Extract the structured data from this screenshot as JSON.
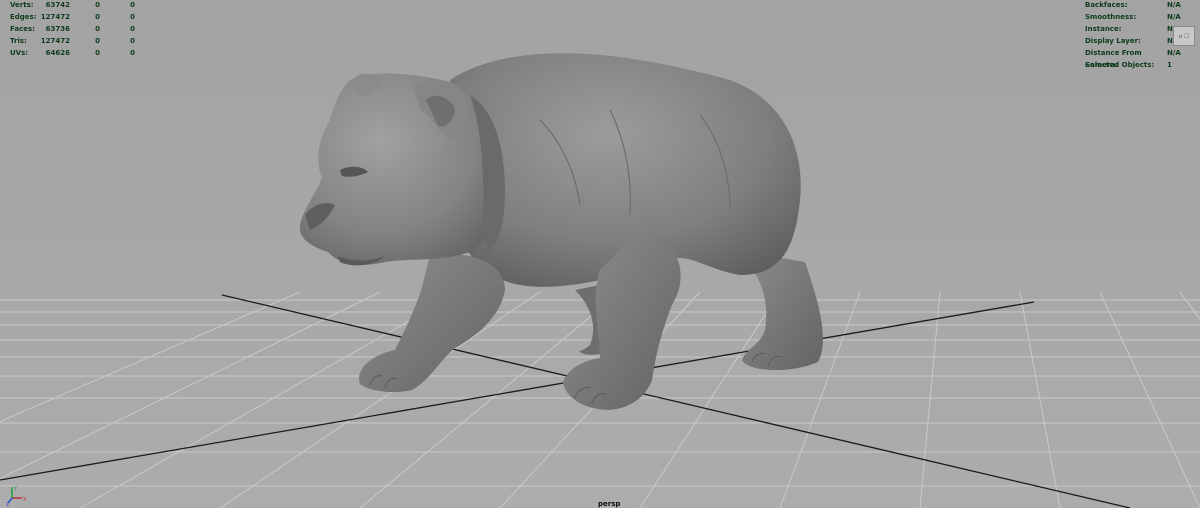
{
  "viewport": {
    "camera_label": "persp"
  },
  "stats_left": [
    {
      "label": "Verts:",
      "v1": "63742",
      "v2": "0",
      "v3": "0"
    },
    {
      "label": "Edges:",
      "v1": "127472",
      "v2": "0",
      "v3": "0"
    },
    {
      "label": "Faces:",
      "v1": "63736",
      "v2": "0",
      "v3": "0"
    },
    {
      "label": "Tris:",
      "v1": "127472",
      "v2": "0",
      "v3": "0"
    },
    {
      "label": "UVs:",
      "v1": "64626",
      "v2": "0",
      "v3": "0"
    }
  ],
  "stats_right": [
    {
      "label": "Backfaces:",
      "value": "N/A"
    },
    {
      "label": "Smoothness:",
      "value": "N/A"
    },
    {
      "label": "Instance:",
      "value": "N/A"
    },
    {
      "label": "Display Layer:",
      "value": "N/A"
    },
    {
      "label": "Distance From Camera:",
      "value": "N/A"
    },
    {
      "label": "Selected Objects:",
      "value": "1"
    }
  ],
  "mini_widget": {
    "text": "¤ ☐"
  },
  "axis": {
    "x": "X",
    "y": "Y",
    "z": "Z"
  },
  "colors": {
    "hud_text": "#0e3b1c",
    "background": "#a9a9a9",
    "grid_line": "#c9c9c9",
    "axis_line": "#1a1a1a",
    "model": "#7e7e7e"
  },
  "model": {
    "name": "bear-mesh"
  }
}
